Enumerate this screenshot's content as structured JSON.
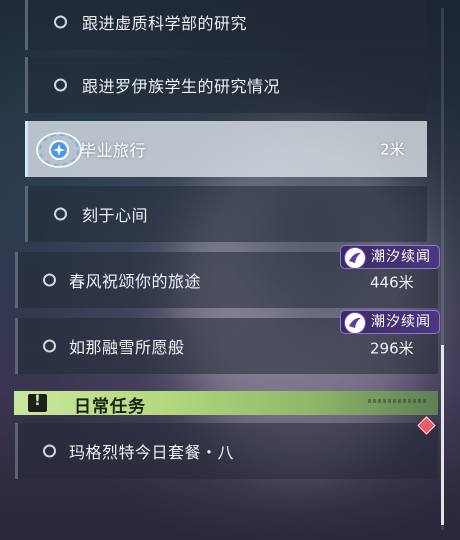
{
  "quests": [
    {
      "label": "跟进虚质科学部的研究"
    },
    {
      "label": "跟进罗伊族学生的研究情况"
    },
    {
      "label": "毕业旅行",
      "distance": "2米"
    },
    {
      "label": "刻于心间"
    },
    {
      "label": "春风祝颂你的旅途",
      "distance": "446米",
      "badge": "潮汐续闻"
    },
    {
      "label": "如那融雪所愿般",
      "distance": "296米",
      "badge": "潮汐续闻"
    }
  ],
  "daily": {
    "header_icon": "!",
    "title": "日常任务",
    "items": [
      {
        "label": "玛格烈特今日套餐・八"
      }
    ]
  },
  "colors": {
    "badge_bg": "#4b3780",
    "daily_header_green": "#c9e79c",
    "selected_row": "#e1e8ee",
    "alert_diamond": "#e85b6b"
  },
  "icons": {
    "tracker": "crosshair-tracker-icon",
    "badge": "tide-emblem-icon",
    "daily": "exclamation-icon",
    "alert": "diamond-alert-icon"
  }
}
